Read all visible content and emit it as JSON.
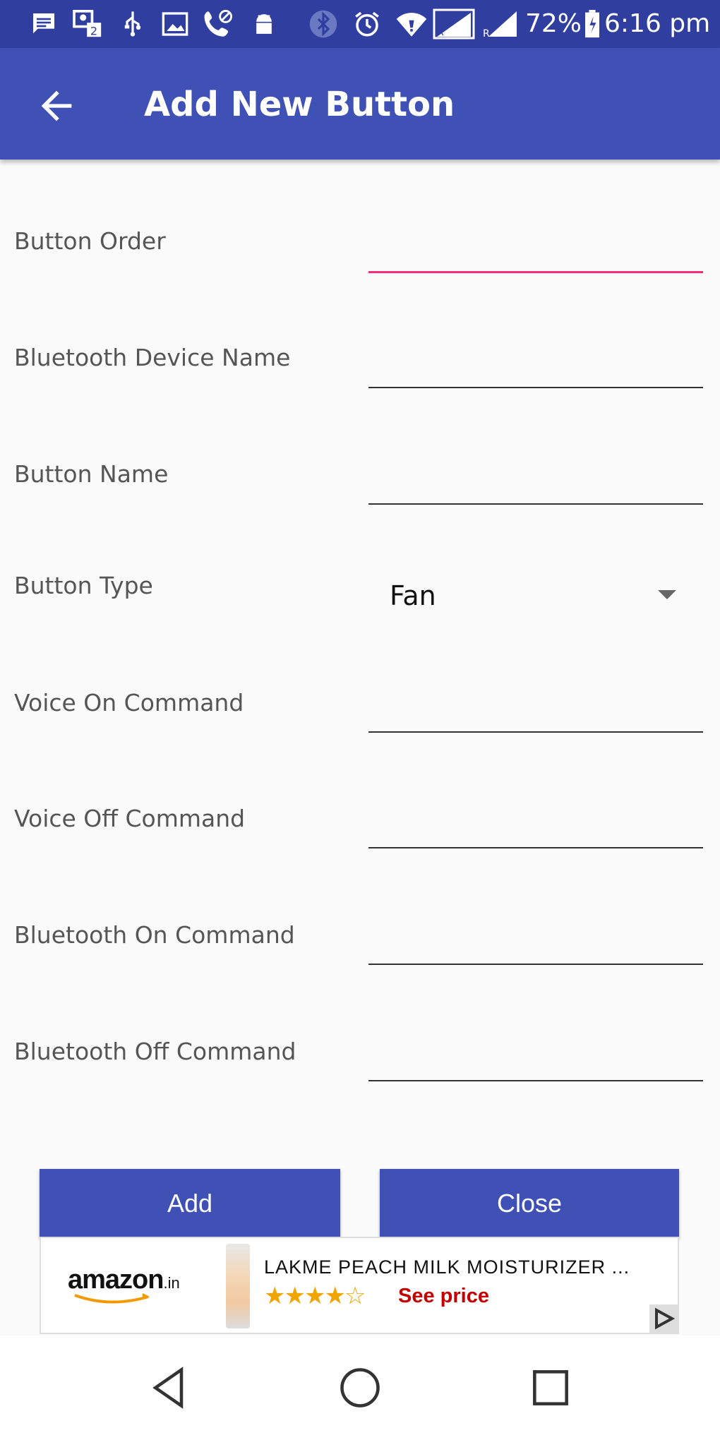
{
  "status_bar": {
    "battery": "72%",
    "time": "6:16 pm",
    "icons": [
      "message-icon",
      "sim-icon",
      "usb-icon",
      "image-icon",
      "call-icon",
      "android-icon",
      "bluetooth-icon",
      "alarm-icon",
      "wifi-icon",
      "signal-icon",
      "signal-icon",
      "battery-icon"
    ]
  },
  "app_bar": {
    "title": "Add New Button",
    "back_icon": "arrow-back-icon"
  },
  "form": {
    "fields": [
      {
        "label": "Button Order",
        "value": ""
      },
      {
        "label": "Bluetooth Device Name",
        "value": ""
      },
      {
        "label": "Button Name",
        "value": ""
      }
    ],
    "button_type": {
      "label": "Button Type",
      "selected": "Fan"
    },
    "fields2": [
      {
        "label": "Voice On Command",
        "value": ""
      },
      {
        "label": "Voice Off Command",
        "value": ""
      },
      {
        "label": "Bluetooth On Command",
        "value": ""
      },
      {
        "label": "Bluetooth Off Command",
        "value": ""
      }
    ]
  },
  "actions": {
    "add": "Add",
    "close": "Close"
  },
  "ad": {
    "brand": "amazon",
    "brand_suffix": ".in",
    "title": "LAKME PEACH MILK MOISTURIZER ...",
    "rating": 4,
    "rating_max": 5,
    "cta": "See price"
  },
  "colors": {
    "status_bar": "#303f9f",
    "app_bar": "#3f51b5",
    "accent": "#ff2d7a",
    "button": "#3f51b5"
  },
  "nav": [
    "back-triangle-icon",
    "home-circle-icon",
    "recents-square-icon"
  ]
}
